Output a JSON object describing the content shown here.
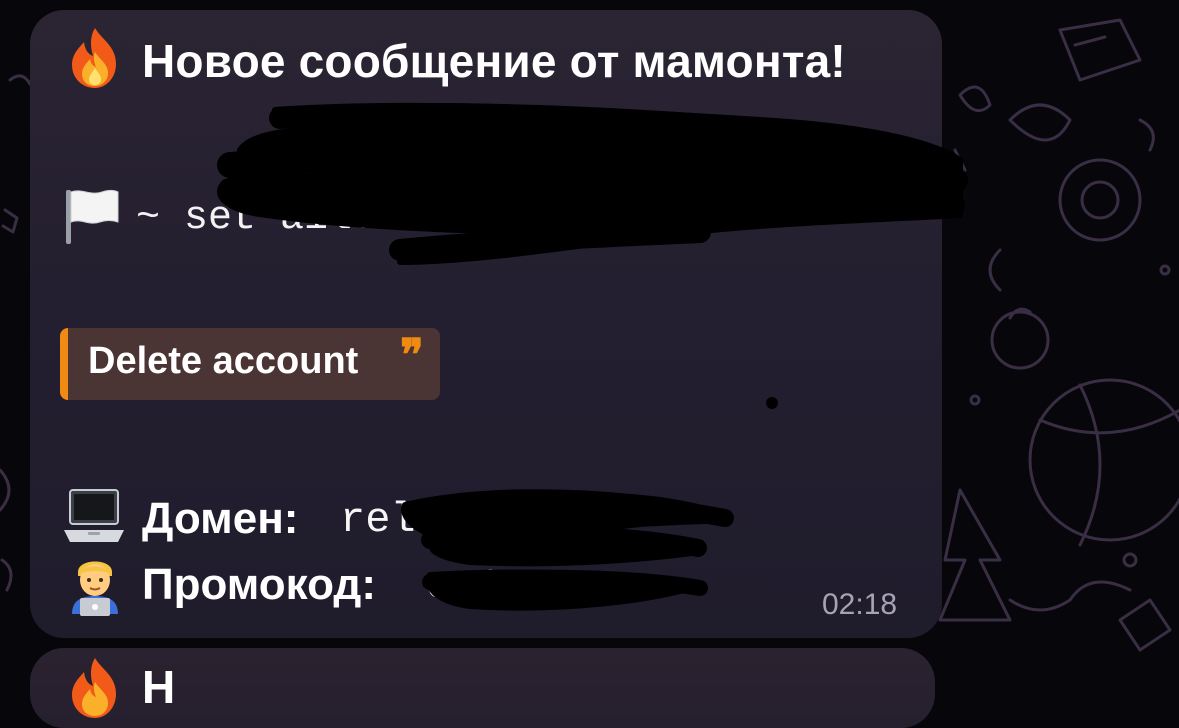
{
  "message": {
    "title": "Новое сообщение от мамонта!",
    "email_visible": "~ set                    ail.com",
    "quote": "Delete account",
    "quote_mark": "❞",
    "domain_label": "Домен:",
    "domain_value": "rel",
    "promo_label": "Промокод:",
    "promo_value": "o  15",
    "time": "02:18",
    "icons": [
      "fire-emoji",
      "white-flag-emoji",
      "laptop-emoji",
      "technologist-emoji"
    ]
  },
  "next_message": {
    "title_partial": "Н"
  },
  "colors": {
    "bubble": "#241f30",
    "quote_bg": "#4a3434",
    "quote_accent": "#f08a12",
    "time": "#a8a2b4",
    "wallpaper": "#07060a",
    "doodles": "#3a2e45"
  }
}
